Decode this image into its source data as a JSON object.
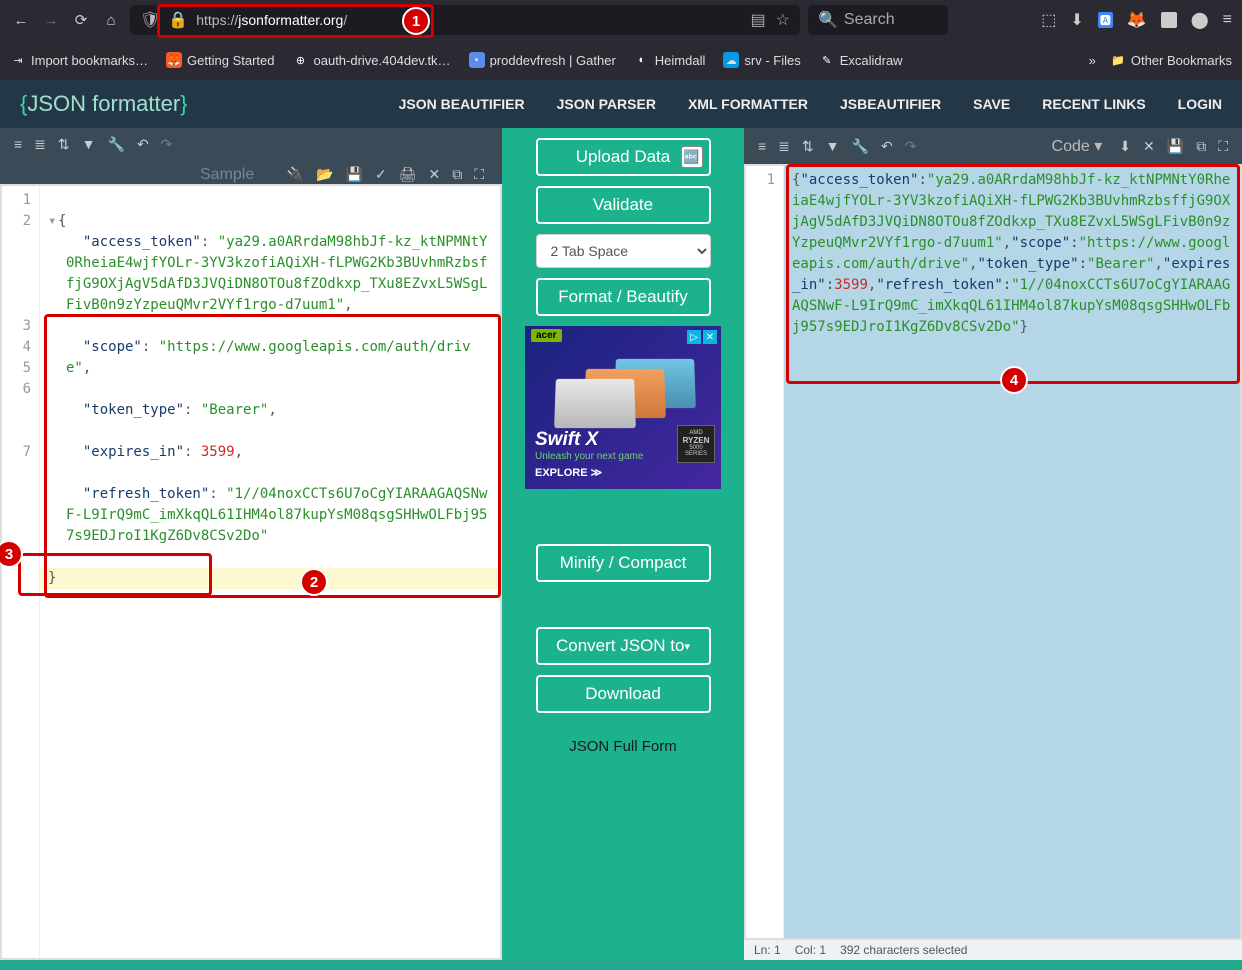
{
  "browser": {
    "url_prefix": "https://",
    "url_domain": "jsonformatter.org",
    "url_rest": "/",
    "search_placeholder": "Search",
    "bookmarks": [
      {
        "label": "Import bookmarks…"
      },
      {
        "label": "Getting Started"
      },
      {
        "label": "oauth-drive.404dev.tk…"
      },
      {
        "label": "proddevfresh | Gather"
      },
      {
        "label": "Heimdall"
      },
      {
        "label": "srv - Files"
      },
      {
        "label": "Excalidraw"
      }
    ],
    "other_bookmarks": "Other Bookmarks"
  },
  "site": {
    "logo_open": "{",
    "logo_text": "JSON formatter",
    "logo_close": "}",
    "nav": [
      "JSON BEAUTIFIER",
      "JSON PARSER",
      "XML FORMATTER",
      "JSBEAUTIFIER",
      "SAVE",
      "RECENT LINKS",
      "LOGIN"
    ]
  },
  "left_panel": {
    "sample_label": "Sample",
    "line_numbers": [
      "1",
      "2",
      "3",
      "4",
      "5",
      "6",
      "7"
    ],
    "json": {
      "access_token_key": "\"access_token\"",
      "access_token_val": "\"ya29.a0ARrdaM98hbJf-kz_ktNPMNtY0RheiaE4wjfYOLr-3YV3kzofiAQiXH-fLPWG2Kb3BUvhmRzbsffjG9OXjAgV5dAfD3JVQiDN8OTOu8fZOdkxp_TXu8EZvxL5WSgLFivB0n9zYzpeuQMvr2VYf1rgo-d7uum1\"",
      "scope_key": "\"scope\"",
      "scope_val": "\"https://www.googleapis.com/auth/drive\"",
      "token_type_key": "\"token_type\"",
      "token_type_val": "\"Bearer\"",
      "expires_in_key": "\"expires_in\"",
      "expires_in_val": "3599",
      "refresh_token_key": "\"refresh_token\"",
      "refresh_token_val": "\"1//04noxCCTs6U7oCgYIARAAGAQSNwF-L9IrQ9mC_imXkqQL61IHM4ol87kupYsM08qsgSHHwOLFbj957s9EDJroI1KgZ6Dv8CSv2Do\""
    }
  },
  "center": {
    "upload": "Upload Data",
    "validate": "Validate",
    "tab_space": "2 Tab Space",
    "format": "Format / Beautify",
    "minify": "Minify / Compact",
    "convert": "Convert JSON to",
    "download": "Download",
    "full_form": "JSON Full Form",
    "ad": {
      "brand": "acer",
      "product": "Swift X",
      "tagline": "Unleash your next game",
      "explore": "EXPLORE ≫",
      "chip1": "AMD",
      "chip2": "RYZEN",
      "chip3": "5000 SERIES"
    }
  },
  "right_panel": {
    "mode": "Code ▾",
    "line_numbers": [
      "1"
    ],
    "output": "{\"access_token\":\"ya29.a0ARrdaM98hbJf-kz_ktNPMNtY0RheiaE4wjfYOLr-3YV3kzofiAQiXH-fLPWG2Kb3BUvhmRzbsffjG9OXjAgV5dAfD3JVQiDN8OTOu8fZOdkxp_TXu8EZvxL5WSgLFivB0n9zYzpeuQMvr2VYf1rgo-d7uum1\",\"scope\":\"https://www.googleapis.com/auth/drive\",\"token_type\":\"Bearer\",\"expires_in\":3599,\"refresh_token\":\"1//04noxCCTs6U7oCgYIARAAGAQSNwF-L9IrQ9mC_imXkqQL61IHM4ol87kupYsM08qsgSHHwOLFbj957s9EDJroI1KgZ6Dv8CSv2Do\"}",
    "status": {
      "ln": "Ln: 1",
      "col": "Col: 1",
      "sel": "392 characters selected"
    }
  },
  "annotations": {
    "c1": "1",
    "c2": "2",
    "c3": "3",
    "c4": "4"
  }
}
